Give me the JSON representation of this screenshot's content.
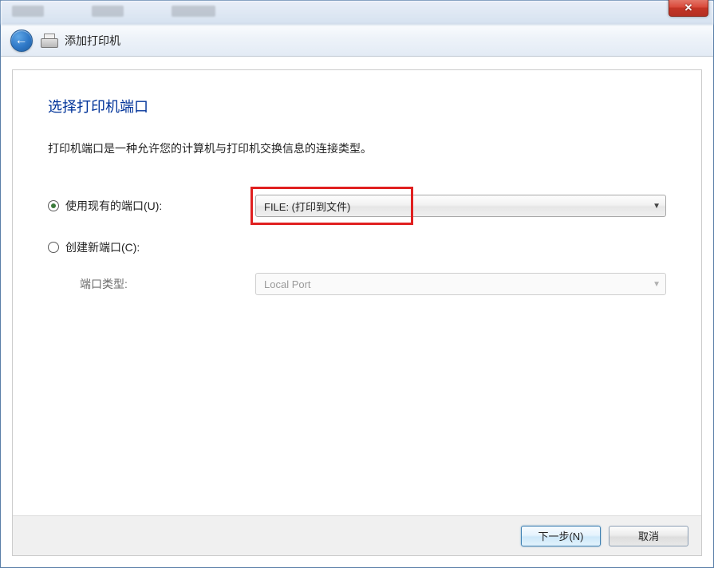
{
  "titlebar": {
    "close_symbol": "✕"
  },
  "header": {
    "back_symbol": "←",
    "title": "添加打印机"
  },
  "page": {
    "heading": "选择打印机端口",
    "description": "打印机端口是一种允许您的计算机与打印机交换信息的连接类型。"
  },
  "options": {
    "existing": {
      "label": "使用现有的端口(U):",
      "selected_value": "FILE: (打印到文件)",
      "checked": true
    },
    "create": {
      "label": "创建新端口(C):",
      "port_type_label": "端口类型:",
      "port_type_value": "Local Port",
      "checked": false
    }
  },
  "buttons": {
    "next": "下一步(N)",
    "cancel": "取消"
  },
  "select_arrow": "▼"
}
